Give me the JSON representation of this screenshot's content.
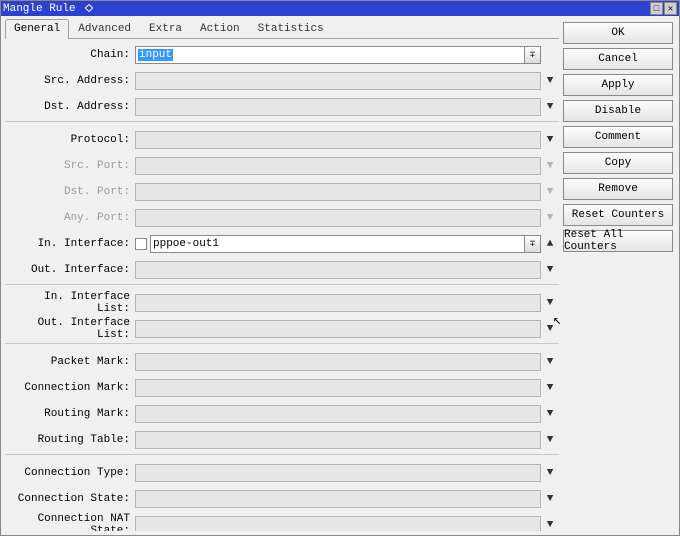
{
  "window": {
    "title": "Mangle Rule"
  },
  "tabs": [
    "General",
    "Advanced",
    "Extra",
    "Action",
    "Statistics"
  ],
  "active_tab": "General",
  "fields": {
    "chain": {
      "label": "Chain:",
      "value": "input"
    },
    "src_address": {
      "label": "Src. Address:",
      "value": ""
    },
    "dst_address": {
      "label": "Dst. Address:",
      "value": ""
    },
    "protocol": {
      "label": "Protocol:",
      "value": ""
    },
    "src_port": {
      "label": "Src. Port:",
      "value": ""
    },
    "dst_port": {
      "label": "Dst. Port:",
      "value": ""
    },
    "any_port": {
      "label": "Any. Port:",
      "value": ""
    },
    "in_interface": {
      "label": "In. Interface:",
      "value": "pppoe-out1"
    },
    "out_interface": {
      "label": "Out. Interface:",
      "value": ""
    },
    "in_interface_list": {
      "label": "In. Interface List:",
      "value": ""
    },
    "out_interface_list": {
      "label": "Out. Interface List:",
      "value": ""
    },
    "packet_mark": {
      "label": "Packet Mark:",
      "value": ""
    },
    "connection_mark": {
      "label": "Connection Mark:",
      "value": ""
    },
    "routing_mark": {
      "label": "Routing Mark:",
      "value": ""
    },
    "routing_table": {
      "label": "Routing Table:",
      "value": ""
    },
    "connection_type": {
      "label": "Connection Type:",
      "value": ""
    },
    "connection_state": {
      "label": "Connection State:",
      "value": ""
    },
    "connection_nat_state": {
      "label": "Connection NAT State:",
      "value": ""
    }
  },
  "buttons": {
    "ok": "OK",
    "cancel": "Cancel",
    "apply": "Apply",
    "disable": "Disable",
    "comment": "Comment",
    "copy": "Copy",
    "remove": "Remove",
    "reset_counters": "Reset Counters",
    "reset_all_counters": "Reset All Counters"
  }
}
